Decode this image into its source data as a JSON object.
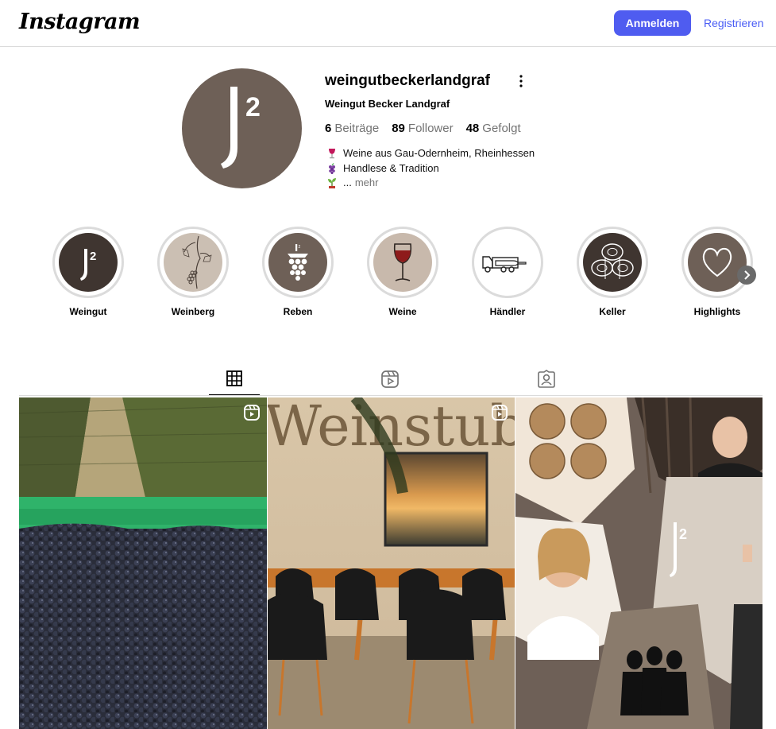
{
  "header": {
    "logo": "Instagram",
    "login_label": "Anmelden",
    "register_label": "Registrieren"
  },
  "profile": {
    "username": "weingutbeckerlandgraf",
    "full_name": "Weingut Becker Landgraf",
    "avatar_text": "J²",
    "stats": {
      "posts_count": "6",
      "posts_label": "Beiträge",
      "followers_count": "89",
      "followers_label": "Follower",
      "following_count": "48",
      "following_label": "Gefolgt"
    },
    "bio": {
      "line1": "Weine aus Gau-Odernheim, Rheinhessen",
      "line2": "Handlese & Tradition",
      "line3_prefix": "...",
      "more_label": "mehr"
    }
  },
  "highlights": [
    {
      "label": "Weingut",
      "icon": "j2-logo-icon"
    },
    {
      "label": "Weinberg",
      "icon": "vine-sketch-icon"
    },
    {
      "label": "Reben",
      "icon": "grape-icon"
    },
    {
      "label": "Weine",
      "icon": "wine-glass-icon"
    },
    {
      "label": "Händler",
      "icon": "delivery-truck-icon"
    },
    {
      "label": "Keller",
      "icon": "barrels-icon"
    },
    {
      "label": "Highlights",
      "icon": "heart-icon"
    }
  ],
  "tabs": [
    {
      "name": "posts",
      "icon": "grid-icon",
      "active": true
    },
    {
      "name": "reels",
      "icon": "reels-icon",
      "active": false
    },
    {
      "name": "tagged",
      "icon": "tagged-icon",
      "active": false
    }
  ],
  "posts": [
    {
      "subject": "grape harvest crate in vineyard",
      "is_reel": true
    },
    {
      "subject": "Weinstube dining room",
      "is_reel": true,
      "overlay_text": "Weinstube"
    },
    {
      "subject": "J² collage with winemakers and barrels",
      "is_reel": false,
      "overlay_text": "J²"
    }
  ],
  "colors": {
    "brand_brown": "#6e6057",
    "button_blue": "#4f5cf0",
    "link_blue": "#4a5df5",
    "border": "#dbdbdb",
    "muted_text": "#737373"
  }
}
